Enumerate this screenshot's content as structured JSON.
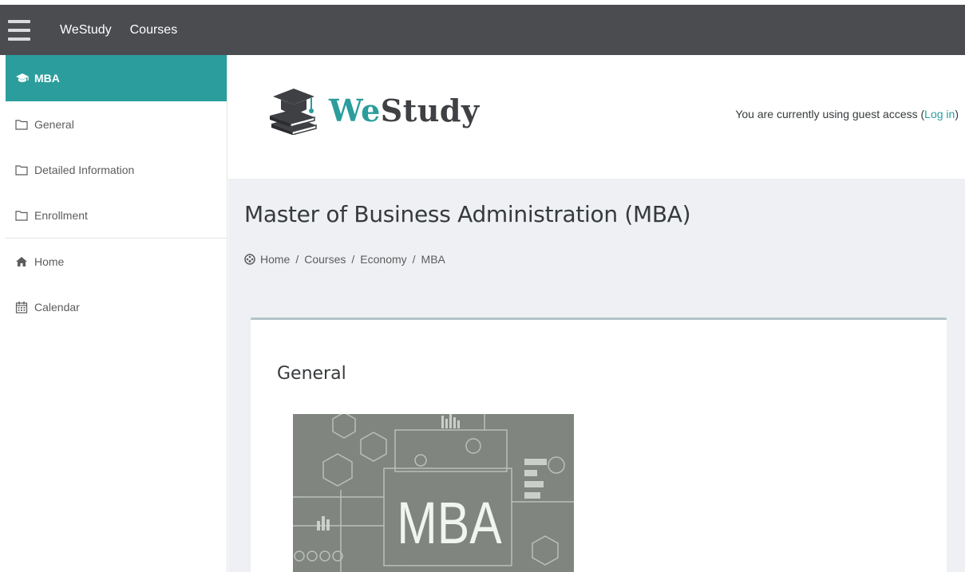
{
  "navbar": {
    "brand": "WeStudy",
    "courses": "Courses"
  },
  "sidebar": {
    "active": "MBA",
    "items": [
      {
        "label": "General",
        "icon": "folder-icon"
      },
      {
        "label": "Detailed Information",
        "icon": "folder-icon"
      },
      {
        "label": "Enrollment",
        "icon": "folder-icon"
      }
    ],
    "links": [
      {
        "label": "Home",
        "icon": "home-icon"
      },
      {
        "label": "Calendar",
        "icon": "calendar-icon"
      }
    ]
  },
  "header": {
    "logo_we": "We",
    "logo_study": "Study",
    "guest_text": "You are currently using guest access (",
    "login": "Log in",
    "guest_close": ")"
  },
  "page": {
    "title": "Master of Business Administration (MBA)",
    "breadcrumb": [
      "Home",
      "Courses",
      "Economy",
      "MBA"
    ]
  },
  "section": {
    "title": "General",
    "image_text": "MBA"
  },
  "colors": {
    "accent": "#2a9d9c",
    "navbar": "#4a4c50",
    "page_bg": "#eef0f3"
  }
}
